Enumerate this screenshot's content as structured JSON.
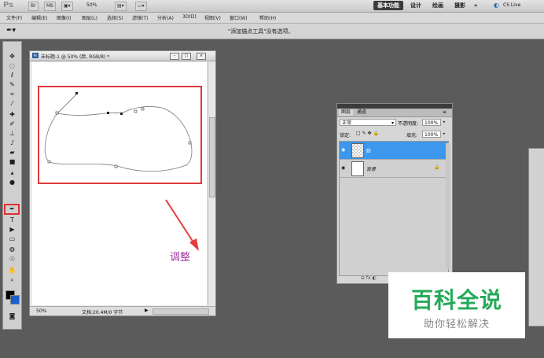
{
  "app": {
    "logo": "Ps",
    "zoom": "50%",
    "workspaces": [
      "基本功能",
      "设计",
      "绘画",
      "摄影",
      "»"
    ],
    "cs_live": "CS Live"
  },
  "menu": [
    "文件(F)",
    "编辑(E)",
    "图像(I)",
    "图层(L)",
    "选择(S)",
    "滤镜(T)",
    "分析(A)",
    "3D(D)",
    "视图(V)",
    "窗口(W)",
    "帮助(H)"
  ],
  "options_bar": {
    "message": "\"添加锚点工具\"没有选项。"
  },
  "document": {
    "title": "未标题-1 @ 50% (脸, RGB/8) *",
    "zoom": "50%",
    "status": "文档:20.4M/0 字节"
  },
  "annotation": "调整",
  "layers_panel": {
    "tabs": [
      "图层",
      "通道"
    ],
    "blend_mode": "正常",
    "opacity_label": "不透明度:",
    "opacity_value": "100%",
    "lock_label": "锁定:",
    "fill_label": "填充:",
    "fill_value": "100%",
    "layers": [
      {
        "name": "脸",
        "selected": true
      },
      {
        "name": "背景",
        "selected": false
      }
    ]
  },
  "watermark": {
    "title": "百科全说",
    "subtitle": "助你轻松解决"
  },
  "colors": {
    "highlight": "#e03030",
    "selection": "#3d97ec",
    "annotation": "#a43aa2",
    "watermark": "#26a95a"
  }
}
